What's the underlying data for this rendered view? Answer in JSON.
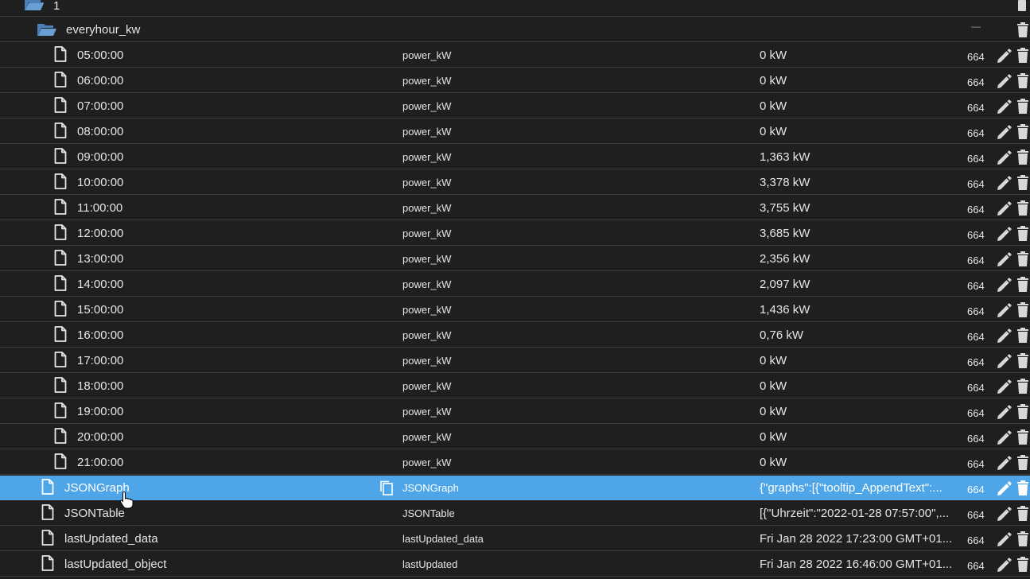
{
  "tree": {
    "parent_folder": {
      "name": "1"
    },
    "folder": {
      "name": "everyhour_kw",
      "collapse_symbol": "—"
    },
    "hour_rows": [
      {
        "name": "05:00:00",
        "role": "power_kW",
        "value": "0 kW",
        "acl": "664"
      },
      {
        "name": "06:00:00",
        "role": "power_kW",
        "value": "0 kW",
        "acl": "664"
      },
      {
        "name": "07:00:00",
        "role": "power_kW",
        "value": "0 kW",
        "acl": "664"
      },
      {
        "name": "08:00:00",
        "role": "power_kW",
        "value": "0 kW",
        "acl": "664"
      },
      {
        "name": "09:00:00",
        "role": "power_kW",
        "value": "1,363 kW",
        "acl": "664"
      },
      {
        "name": "10:00:00",
        "role": "power_kW",
        "value": "3,378 kW",
        "acl": "664"
      },
      {
        "name": "11:00:00",
        "role": "power_kW",
        "value": "3,755 kW",
        "acl": "664"
      },
      {
        "name": "12:00:00",
        "role": "power_kW",
        "value": "3,685 kW",
        "acl": "664"
      },
      {
        "name": "13:00:00",
        "role": "power_kW",
        "value": "2,356 kW",
        "acl": "664"
      },
      {
        "name": "14:00:00",
        "role": "power_kW",
        "value": "2,097 kW",
        "acl": "664"
      },
      {
        "name": "15:00:00",
        "role": "power_kW",
        "value": "1,436 kW",
        "acl": "664"
      },
      {
        "name": "16:00:00",
        "role": "power_kW",
        "value": "0,76 kW",
        "acl": "664"
      },
      {
        "name": "17:00:00",
        "role": "power_kW",
        "value": "0 kW",
        "acl": "664"
      },
      {
        "name": "18:00:00",
        "role": "power_kW",
        "value": "0 kW",
        "acl": "664"
      },
      {
        "name": "19:00:00",
        "role": "power_kW",
        "value": "0 kW",
        "acl": "664"
      },
      {
        "name": "20:00:00",
        "role": "power_kW",
        "value": "0 kW",
        "acl": "664"
      },
      {
        "name": "21:00:00",
        "role": "power_kW",
        "value": "0 kW",
        "acl": "664"
      }
    ],
    "object_rows": [
      {
        "name": "JSONGraph",
        "role": "JSONGraph",
        "value": "{\"graphs\":[{\"tooltip_AppendText\":...",
        "acl": "664",
        "selected": true
      },
      {
        "name": "JSONTable",
        "role": "JSONTable",
        "value": "[{\"Uhrzeit\":\"2022-01-28 07:57:00\",...",
        "acl": "664",
        "selected": false
      },
      {
        "name": "lastUpdated_data",
        "role": "lastUpdated_data",
        "value": "Fri Jan 28 2022 17:23:00 GMT+01...",
        "acl": "664",
        "selected": false
      },
      {
        "name": "lastUpdated_object",
        "role": "lastUpdated",
        "value": "Fri Jan 28 2022 16:46:00 GMT+01...",
        "acl": "664",
        "selected": false
      }
    ]
  },
  "icons": {
    "folder": "folder-open-icon",
    "file": "file-icon",
    "edit": "pencil-icon",
    "delete": "trash-icon",
    "copy": "copy-icon",
    "cursor": "hand-pointer-icon"
  },
  "colors": {
    "background": "#1f1f1f",
    "row_border": "#3a3a3a",
    "selected_row": "#4ea6e8",
    "folder": "#4a7fb8",
    "text": "#e6e6e6"
  }
}
